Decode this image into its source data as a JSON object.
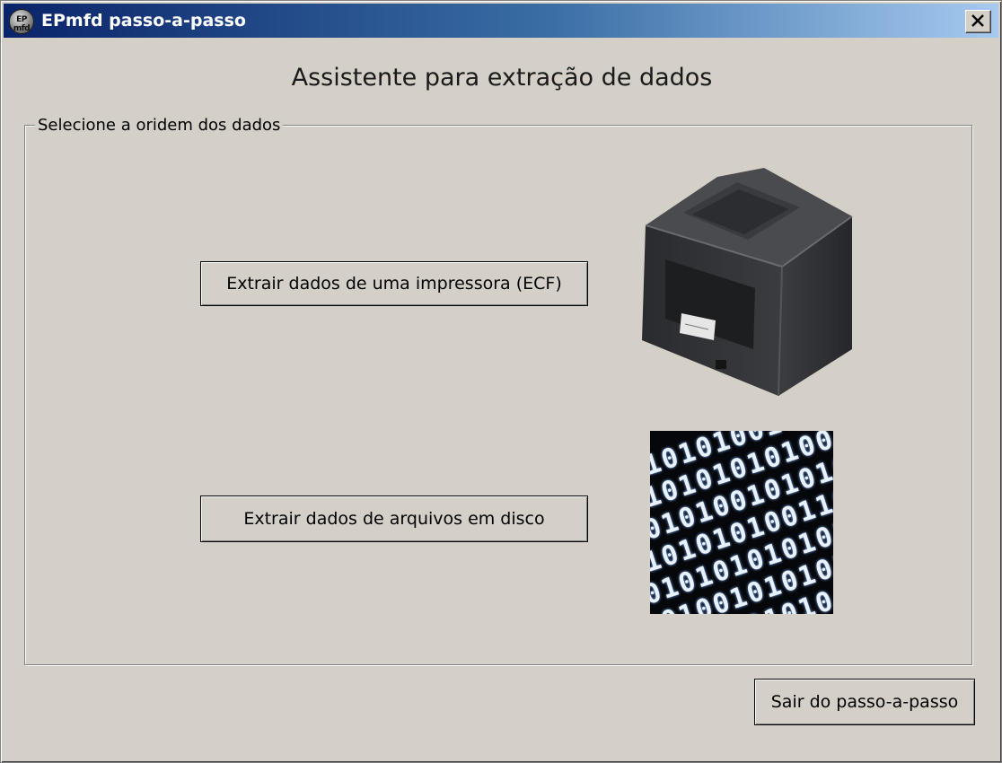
{
  "window": {
    "title": "EPmfd passo-a-passo",
    "icon": "app-logo-icon",
    "icon_text": "EP mfd",
    "close_icon": "close-icon"
  },
  "main": {
    "heading": "Assistente para extração de dados",
    "group_label": "Selecione a oridem dos dados",
    "buttons": {
      "ecf": "Extrair dados de uma impressora (ECF)",
      "disk": "Extrair dados de arquivos em disco",
      "exit": "Sair do passo-a-passo"
    },
    "images": {
      "printer": "printer-image",
      "binary": "binary-data-image"
    }
  },
  "colors": {
    "window_bg": "#d4d0c8",
    "title_start": "#0a246a",
    "title_end": "#a6caf0"
  }
}
